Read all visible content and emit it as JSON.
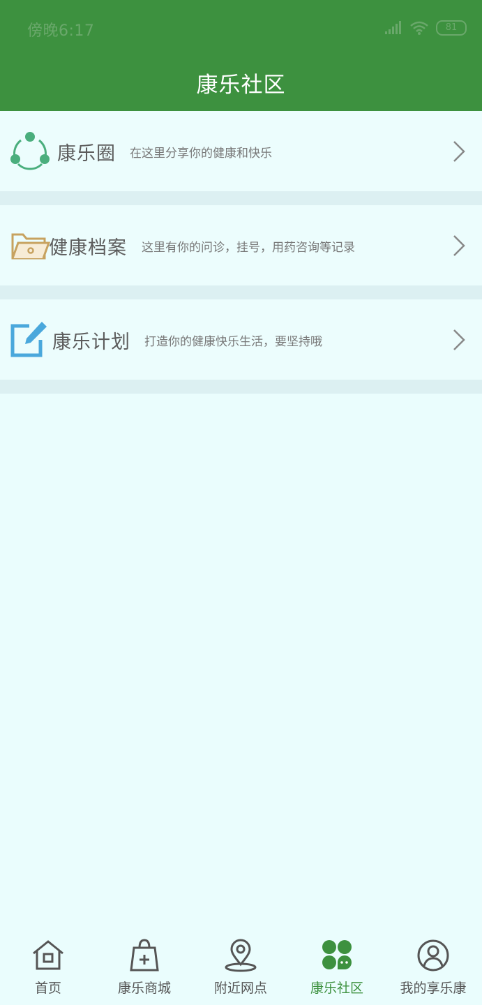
{
  "status_bar": {
    "time": "傍晚6:17",
    "battery": "81",
    "signal_icon": "signal-bars-icon",
    "wifi_icon": "wifi-icon"
  },
  "header": {
    "title": "康乐社区"
  },
  "menu": [
    {
      "title": "康乐圈",
      "description": "在这里分享你的健康和快乐",
      "icon": "share-circle-icon",
      "icon_color": "#4aae7d"
    },
    {
      "title": "健康档案",
      "description": "这里有你的问诊，挂号，用药咨询等记录",
      "icon": "folder-icon",
      "icon_color": "#c7a25f"
    },
    {
      "title": "康乐计划",
      "description": "打造你的健康快乐生活，要坚持哦",
      "icon": "edit-note-icon",
      "icon_color": "#4aa8dc"
    }
  ],
  "tabs": [
    {
      "label": "首页",
      "icon": "home-icon",
      "active": false
    },
    {
      "label": "康乐商城",
      "icon": "shopping-bag-icon",
      "active": false
    },
    {
      "label": "附近网点",
      "icon": "location-pin-icon",
      "active": false
    },
    {
      "label": "康乐社区",
      "icon": "community-icon",
      "active": true
    },
    {
      "label": "我的享乐康",
      "icon": "user-profile-icon",
      "active": false
    }
  ],
  "colors": {
    "header_bg": "#3d913f",
    "page_bg": "#eafdfd",
    "active_tab": "#3d913f"
  }
}
